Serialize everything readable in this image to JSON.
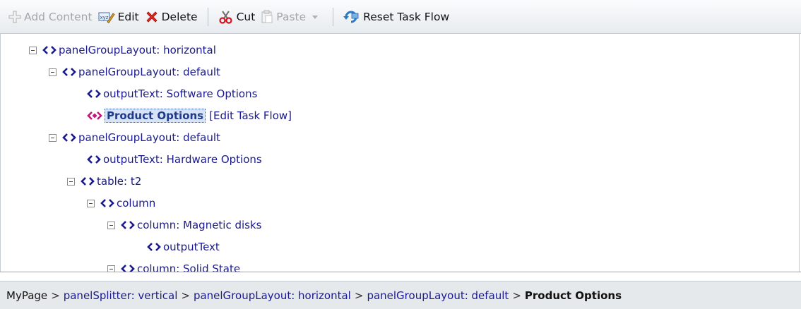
{
  "toolbar": {
    "add_content": "Add Content",
    "edit": "Edit",
    "delete": "Delete",
    "cut": "Cut",
    "paste": "Paste",
    "reset_task_flow": "Reset Task Flow"
  },
  "tree": {
    "nodes": [
      {
        "label": "panelGroupLayout: horizontal",
        "expanded": true
      },
      {
        "label": "panelGroupLayout: default",
        "expanded": true
      },
      {
        "label": "outputText: Software Options"
      },
      {
        "label": "Product Options",
        "selected": true,
        "link": "[Edit Task Flow]"
      },
      {
        "label": "panelGroupLayout: default",
        "expanded": true
      },
      {
        "label": "outputText: Hardware Options"
      },
      {
        "label": "table: t2",
        "expanded": true
      },
      {
        "label": "column",
        "expanded": true
      },
      {
        "label": "column: Magnetic disks",
        "expanded": true
      },
      {
        "label": "outputText"
      },
      {
        "label": "column: Solid State",
        "expanded": true
      }
    ]
  },
  "breadcrumb": {
    "items": [
      "MyPage",
      "panelSplitter: vertical",
      "panelGroupLayout: horizontal",
      "panelGroupLayout: default",
      "Product Options"
    ],
    "separator": ">"
  },
  "colors": {
    "node_text": "#1a1a8c",
    "selected_icon": "#c2187a",
    "toolbar_bg": "#e6ebef"
  }
}
